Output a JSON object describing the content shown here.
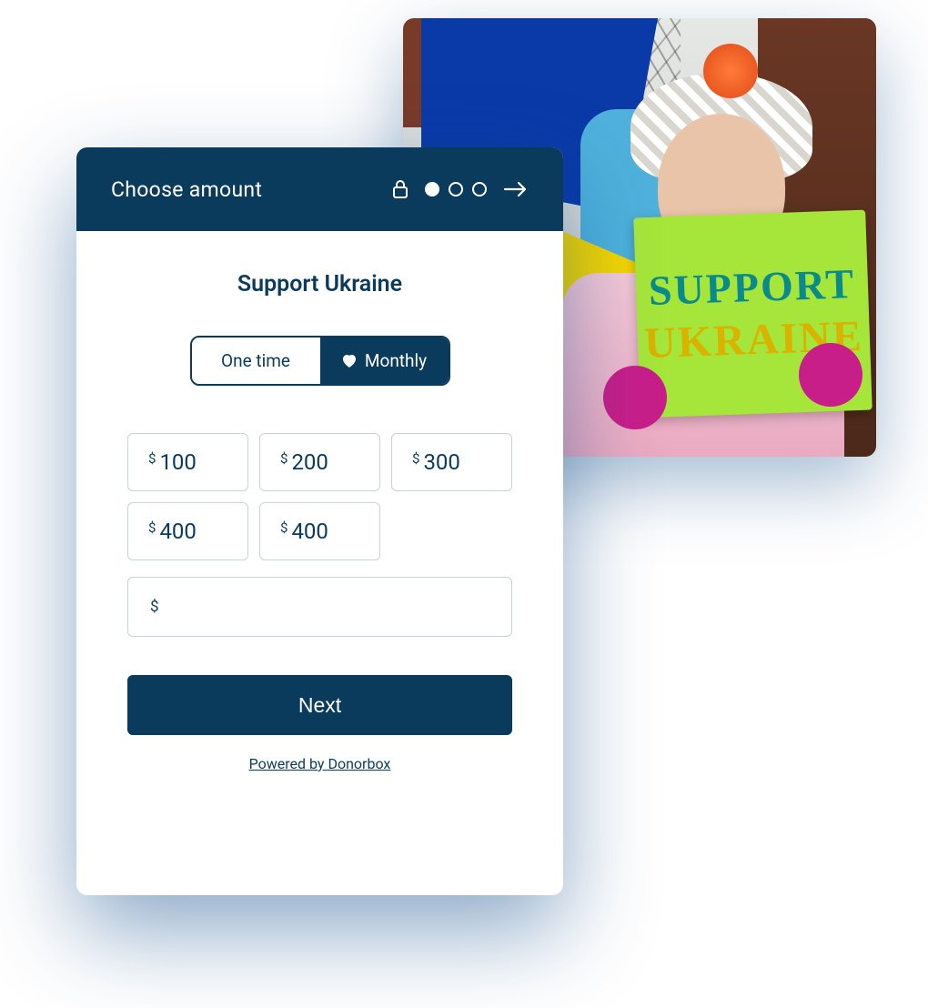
{
  "photo": {
    "sign_line1": "SUPPORT",
    "sign_line2": "UKRAINE"
  },
  "header": {
    "title": "Choose amount",
    "steps_total": 3,
    "step_active": 1
  },
  "campaign": {
    "title": "Support Ukraine"
  },
  "frequency": {
    "one_time_label": "One time",
    "monthly_label": "Monthly",
    "active": "monthly"
  },
  "amounts": {
    "currency_symbol": "$",
    "options": [
      "100",
      "200",
      "300",
      "400",
      "400"
    ],
    "custom_value": ""
  },
  "actions": {
    "next_label": "Next"
  },
  "footer": {
    "powered_by": "Powered by Donorbox"
  }
}
